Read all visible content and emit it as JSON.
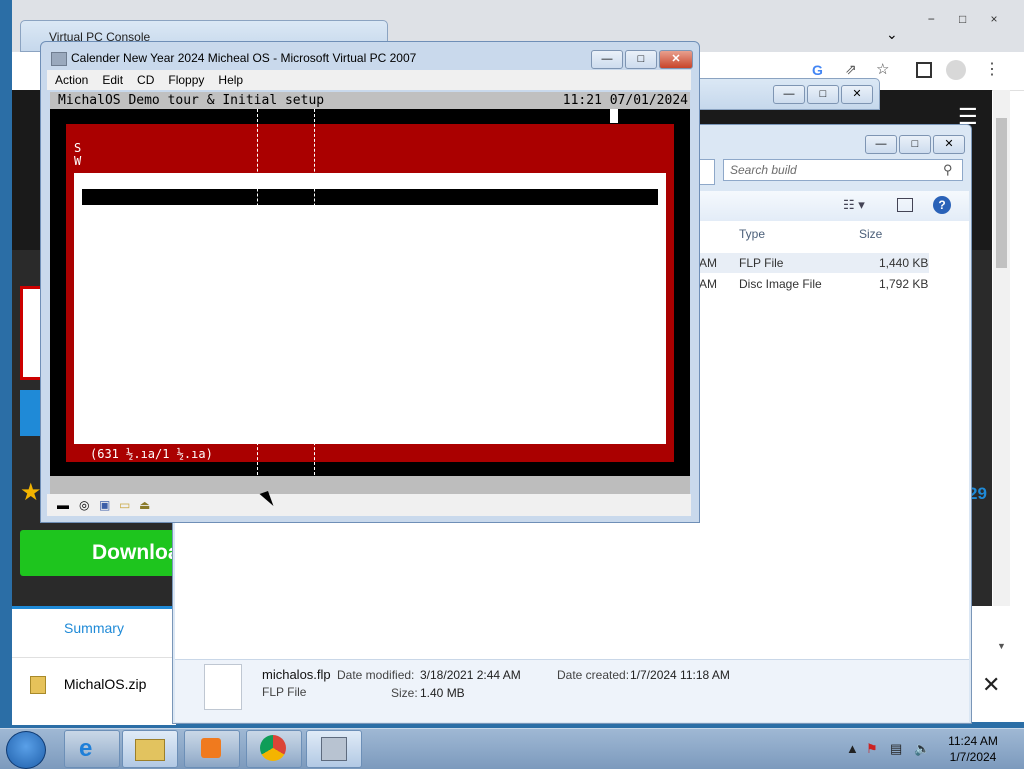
{
  "chrome": {
    "window_buttons": [
      "−",
      "□",
      "×"
    ],
    "toolbar_icons": [
      "google-icon",
      "share-icon",
      "star-icon",
      "sidebar-icon",
      "profile-icon",
      "menu-icon"
    ],
    "download_label": "Download",
    "number_partial": "29",
    "summary_tab": "Summary",
    "download_file": "MichalOS.zip"
  },
  "vpc_console": {
    "title": "Virtual PC Console"
  },
  "explorer": {
    "search_placeholder": "Search build",
    "columns": {
      "type": "Type",
      "size": "Size"
    },
    "rows": [
      {
        "modified_tail": "AM",
        "type": "FLP File",
        "size": "1,440 KB"
      },
      {
        "modified_tail": "AM",
        "type": "Disc Image File",
        "size": "1,792 KB"
      }
    ],
    "details": {
      "name": "michalos.flp",
      "type": "FLP File",
      "date_modified_label": "Date modified:",
      "date_modified": "3/18/2021 2:44 AM",
      "date_created_label": "Date created:",
      "date_created": "1/7/2024 11:18 AM",
      "size_label": "Size:",
      "size": "1.40 MB"
    }
  },
  "vpc": {
    "title": "Calender New Year 2024 Micheal OS - Microsoft Virtual PC 2007",
    "menu": [
      "Action",
      "Edit",
      "CD",
      "Floppy",
      "Help"
    ],
    "screen": {
      "header_left": "MichalOS Demo tour & Initial setup",
      "header_right": "11:21 07/01/2024",
      "side_letters": [
        "S",
        "W"
      ],
      "status_line": "(631 ½.ıa/1 ½.ıa)"
    }
  },
  "taskbar": {
    "clock_time": "11:24 AM",
    "clock_date": "1/7/2024",
    "pinned": [
      "ie-icon",
      "explorer-icon",
      "media-player-icon",
      "chrome-icon",
      "virtual-pc-icon"
    ]
  }
}
